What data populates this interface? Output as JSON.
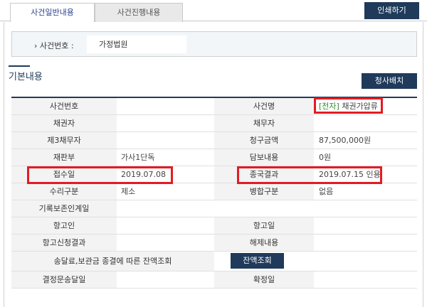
{
  "tabs": [
    {
      "label": "사건일반내용",
      "active": true
    },
    {
      "label": "사건진행내용",
      "active": false
    }
  ],
  "print_button": "인쇄하기",
  "case_box": {
    "label": "사건번호 :",
    "value": "가정법원",
    "prefix": "›"
  },
  "section": {
    "title": "기본내용",
    "button": "청사배치"
  },
  "rows": {
    "r1": {
      "h1": "사건번호",
      "v1": "",
      "h2": "사건명",
      "v2_tag": "[전자]",
      "v2": " 채권가압류"
    },
    "r2": {
      "h1": "채권자",
      "v1": "",
      "h2": "채무자",
      "v2": ""
    },
    "r3": {
      "h1": "제3채무자",
      "v1": "",
      "h2": "청구금액",
      "v2": "87,500,000원"
    },
    "r4": {
      "h1": "재판부",
      "v1": "가사1단독",
      "h2": "담보내용",
      "v2": "0원"
    },
    "r5": {
      "h1": "접수일",
      "v1": "2019.07.08",
      "h2": "종국결과",
      "v2": "2019.07.15 인용"
    },
    "r6": {
      "h1": "수리구분",
      "v1": "제소",
      "h2": "병합구분",
      "v2": "없음"
    },
    "r7": {
      "h1": "기록보존인계일",
      "v1": ""
    },
    "r8": {
      "h1": "항고인",
      "v1": "",
      "h2": "항고일",
      "v2": ""
    },
    "r9": {
      "h1": "항고신청결과",
      "v1": "",
      "h2": "해제내용",
      "v2": ""
    },
    "r10": {
      "h1": "송달료,보관금 종결에 따른 잔액조회",
      "button": "잔액조회"
    },
    "r11": {
      "h1": "결정문송달일",
      "v1": "",
      "h2": "확정일",
      "v2": ""
    }
  },
  "colors": {
    "navy": "#1f3a5a",
    "highlight_red": "#e21c23",
    "tag_green": "#2e8b2e"
  }
}
